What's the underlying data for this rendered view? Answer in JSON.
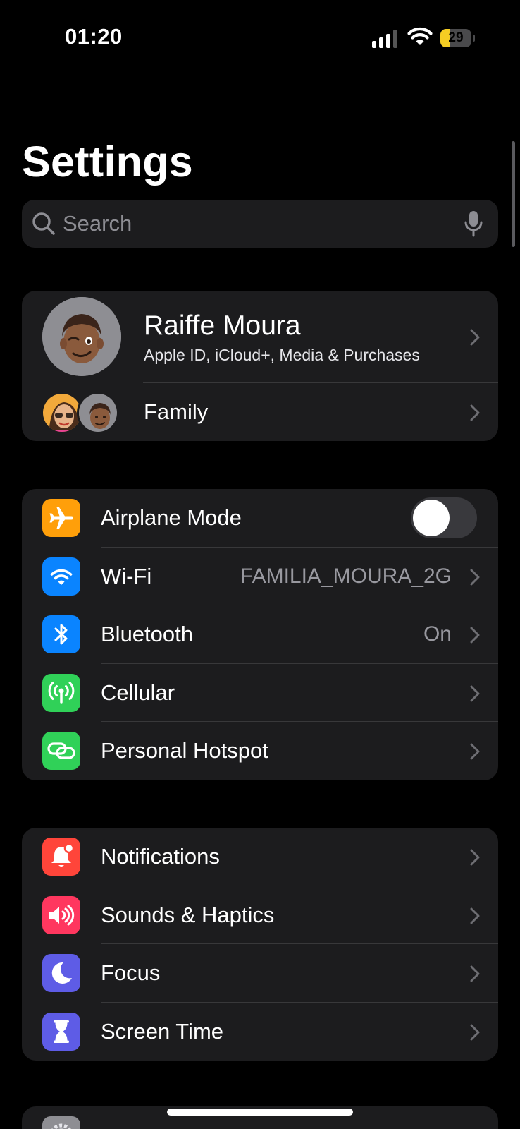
{
  "status_bar": {
    "time": "01:20",
    "battery_level": "29",
    "battery_fraction": 0.29,
    "signal_bars": 3,
    "signal_bars_total": 4
  },
  "page": {
    "title": "Settings"
  },
  "search": {
    "placeholder": "Search"
  },
  "profile": {
    "name": "Raiffe Moura",
    "subtitle": "Apple ID, iCloud+, Media & Purchases",
    "family_label": "Family"
  },
  "connectivity": {
    "airplane_mode": {
      "label": "Airplane Mode",
      "enabled": false,
      "icon": "airplane-icon",
      "color": "#ff9f0a"
    },
    "wifi": {
      "label": "Wi-Fi",
      "value": "FAMILIA_MOURA_2G",
      "icon": "wifi-icon",
      "color": "#0a84ff"
    },
    "bluetooth": {
      "label": "Bluetooth",
      "value": "On",
      "icon": "bluetooth-icon",
      "color": "#0a84ff"
    },
    "cellular": {
      "label": "Cellular",
      "icon": "antenna-icon",
      "color": "#30d158"
    },
    "hotspot": {
      "label": "Personal Hotspot",
      "icon": "chain-link-icon",
      "color": "#30d158"
    }
  },
  "alerts": {
    "notifications": {
      "label": "Notifications",
      "icon": "bell-icon",
      "color": "#ff453a"
    },
    "sounds": {
      "label": "Sounds & Haptics",
      "icon": "speaker-icon",
      "color": "#ff375f"
    },
    "focus": {
      "label": "Focus",
      "icon": "moon-icon",
      "color": "#5e5ce6"
    },
    "screen_time": {
      "label": "Screen Time",
      "icon": "hourglass-icon",
      "color": "#5e5ce6"
    }
  },
  "general": {
    "icon": "gear-icon",
    "color": "#8e8e93"
  }
}
